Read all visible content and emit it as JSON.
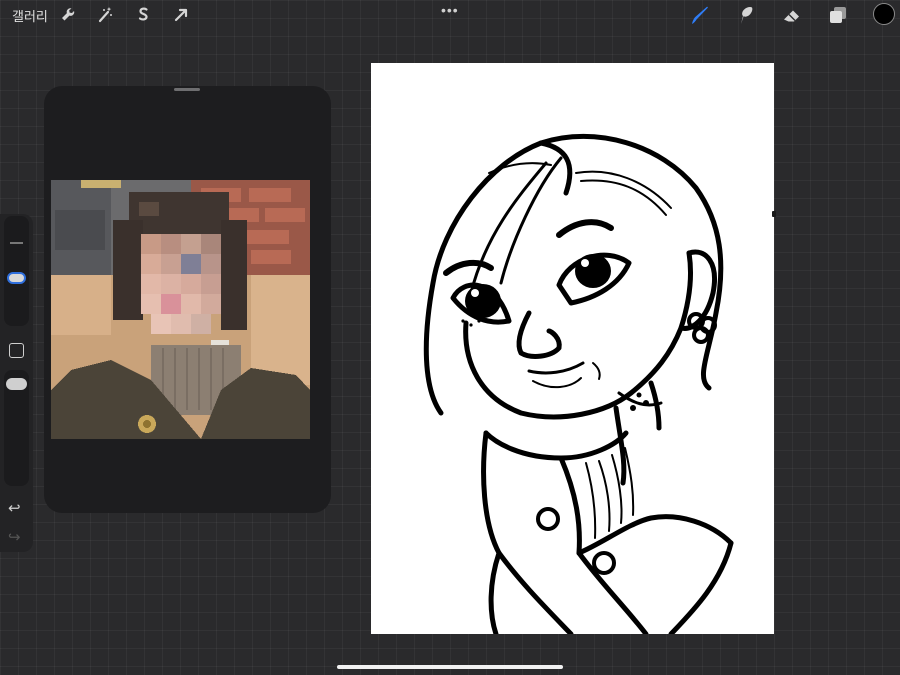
{
  "topbar": {
    "gallery_label": "갤러리",
    "left_tools": [
      "wrench-icon",
      "magic-wand-icon",
      "selection-s-icon",
      "transform-arrow-icon"
    ],
    "more_label": "•••",
    "right_tools": [
      "brush-icon",
      "smudge-icon",
      "eraser-icon",
      "layers-icon"
    ],
    "active_tool": "brush-icon",
    "active_tool_color": "#2f7df6",
    "current_color": "#000000"
  },
  "sidebar": {
    "undo_glyph": "↩",
    "redo_glyph": "↪",
    "accent_color": "#2f6fdd"
  },
  "reference": {
    "content": "reference-photo-pixelated-face"
  },
  "canvas": {
    "background": "#ffffff",
    "content": "ink-line-caricature-portrait"
  }
}
